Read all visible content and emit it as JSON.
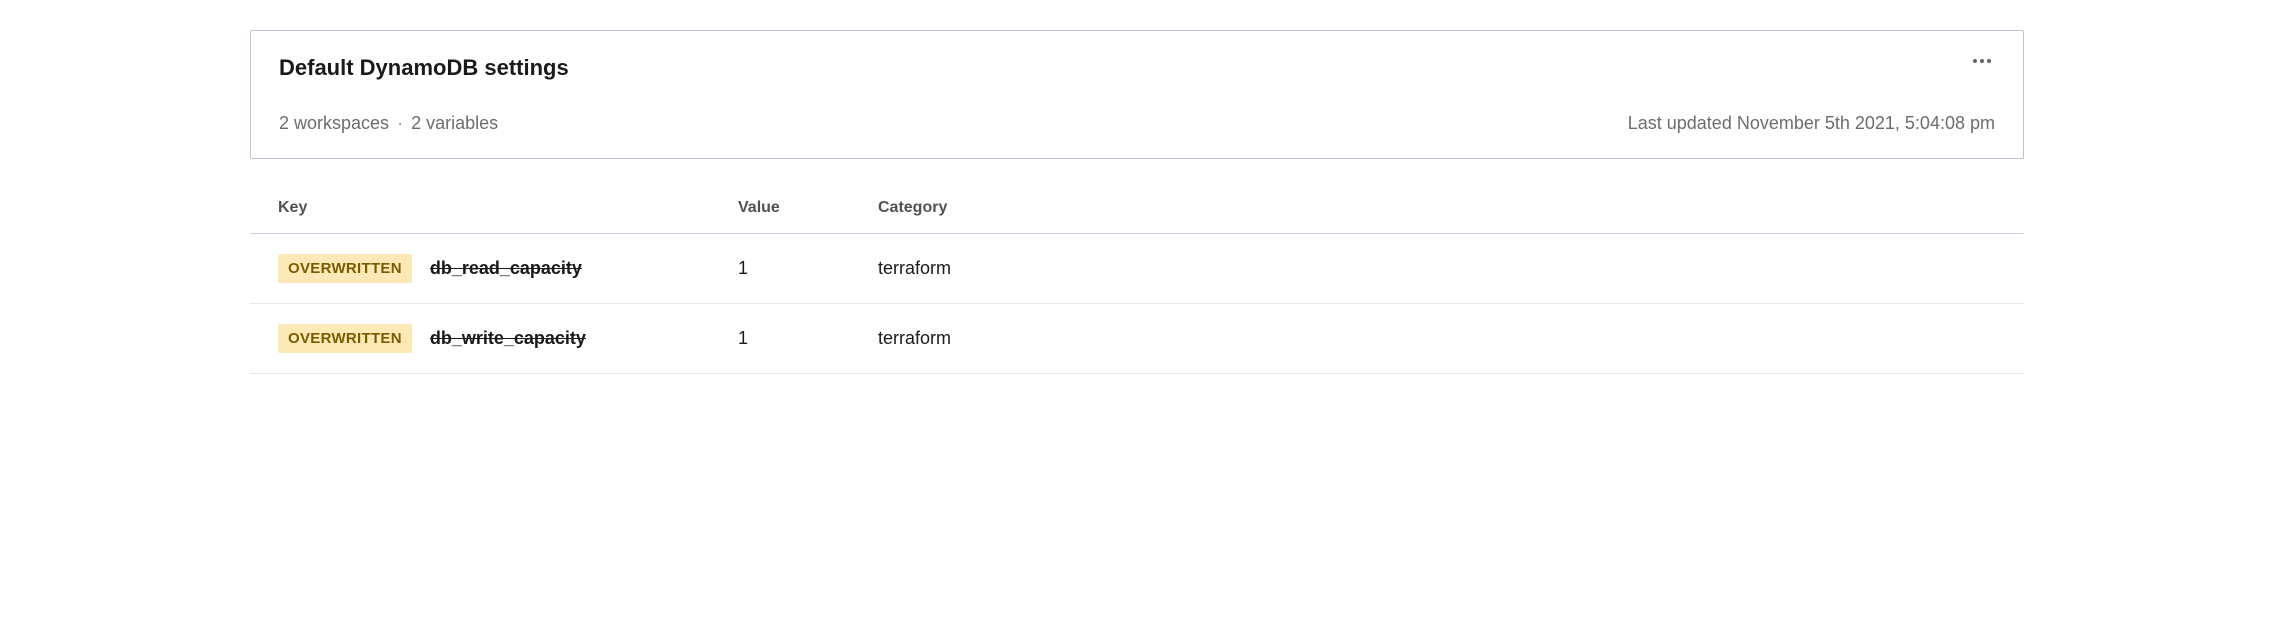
{
  "card": {
    "title": "Default DynamoDB settings",
    "workspaces": "2 workspaces",
    "variables": "2 variables",
    "separator": "·",
    "last_updated": "Last updated November 5th 2021, 5:04:08 pm"
  },
  "table": {
    "headers": {
      "key": "Key",
      "value": "Value",
      "category": "Category"
    },
    "rows": [
      {
        "badge": "OVERWRITTEN",
        "key": "db_read_capacity",
        "value": "1",
        "category": "terraform"
      },
      {
        "badge": "OVERWRITTEN",
        "key": "db_write_capacity",
        "value": "1",
        "category": "terraform"
      }
    ]
  }
}
